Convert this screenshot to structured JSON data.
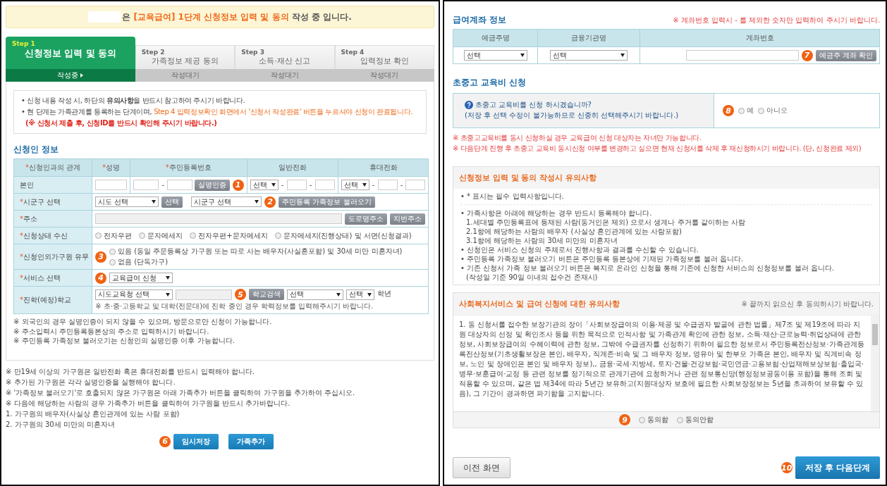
{
  "banner": {
    "segments": [
      {
        "text": "은 ",
        "highlighted": false
      },
      {
        "text": "[교육급여] 1단계 신청정보 입력 및 동의",
        "highlighted": true
      },
      {
        "text": " 작성 중 입니다.",
        "highlighted": false
      }
    ]
  },
  "steps": [
    {
      "step": "Step 1",
      "title": "신청정보 입력 및 동의",
      "status": "작성중",
      "selected": true
    },
    {
      "step": "Step 2",
      "title": "가족정보 제공 동의",
      "status": "작성대기",
      "selected": false
    },
    {
      "step": "Step 3",
      "title": "소득·재산 신고",
      "status": "작성대기",
      "selected": false
    },
    {
      "step": "Step 4",
      "title": "입력정보 확인",
      "status": "작성대기",
      "selected": false
    }
  ],
  "notice": [
    {
      "alert": false,
      "segments": [
        {
          "text": "• 신청 내용 작성 시, 하단의 **유의사항**을 반드시 참고하여 주시기 바랍니다.",
          "highlighted": false
        }
      ]
    },
    {
      "alert": false,
      "segments": [
        {
          "text": "• 현 단계는 가족관계를 등록하는 단계이며, ",
          "highlighted": false
        },
        {
          "text": "Step 4 입력정보확인 화면에서 '신청서 작성완료' 버튼을 누르셔야 신청이 완료됩니다.",
          "highlighted": true
        }
      ]
    },
    {
      "alert": true,
      "segments": [
        {
          "text": "(※ 신청서 제출 후, 신청ID를 반드시 확인해 주시기 바랍니다.)",
          "highlighted": false
        }
      ]
    }
  ],
  "applicant": {
    "title": "신청인 정보",
    "columns": [
      {
        "mark": "*",
        "label": "신청인과의 관계"
      },
      {
        "mark": "*",
        "label": "성명"
      },
      {
        "mark": "*",
        "label": "주민등록번호"
      },
      {
        "label": "일반전화"
      },
      {
        "label": "휴대전화"
      }
    ],
    "self_row": {
      "relation": "본인",
      "separator": "-",
      "verify_button": "실명인증",
      "marker": "1",
      "phone_select": "선택",
      "mobile_select": "선택"
    },
    "rows": [
      {
        "kind": "region",
        "mark": "*",
        "label": "시군구 선택",
        "province_select": "시도 선택",
        "select_button": "선택",
        "district_select": "시군구 선택",
        "load_button_marker": "2",
        "load_button": "주민등록 가족정보 불러오기"
      },
      {
        "kind": "address",
        "mark": "*",
        "label": "주소",
        "buttons": [
          "도로명주소",
          "지번주소"
        ]
      },
      {
        "kind": "radios",
        "mark": "*",
        "label": "신청상태 수신",
        "options": [
          {
            "label": "전자우편",
            "selected": false
          },
          {
            "label": "문자메세지",
            "selected": false
          },
          {
            "label": "전자우편+문자메세지",
            "selected": false
          },
          {
            "label": "문자메세지(진행상태) 및 서면(신청결과)",
            "selected": false
          }
        ]
      },
      {
        "kind": "radio_stack",
        "mark": "*",
        "label": "신청인외가구원 유무",
        "marker": "3",
        "options": [
          {
            "label": "있음 (동일 주문등록상 가구원 또는 따로 사는 배우자(사실혼포함) 및 30세 미만 미혼자녀)",
            "selected": false
          },
          {
            "label": "없음 (단독가구)",
            "selected": false
          }
        ]
      },
      {
        "kind": "service",
        "mark": "*",
        "label": "서비스 선택",
        "marker": "4",
        "select": "교육급여 신청"
      },
      {
        "kind": "school",
        "mark": "*",
        "label": "진학(예정)학교",
        "edu_select": "시도교육청 선택",
        "search_button_marker": "5",
        "search_button": "학교검색",
        "school_select": "선택",
        "grade_select": "선택",
        "grade_unit": "학년",
        "note": "※ 초·중·고등학교 및 대학(전문대)에 진학 중인 경우 학력정보를 입력해주시기 바랍니다."
      }
    ],
    "notes": [
      "※ 외국인의 경우 실명인증이 되지 않을 수 있으며, 방문으로만 신청이 가능합니다.",
      "※ 주소입력시 주민등록등본상의 주소로 입력하시기 바랍니다.",
      "※ 주민등록 가족정보 불러오기는 신청인의 실명인증 이후 가능합니다."
    ]
  },
  "family_notes": [
    "※ 만19세 이상의 가구원은 일반전화 혹은 휴대전화를 반드시 입력해야 합니다.",
    "※ 추가된 가구원은 각각 실명인증을 실행해야 합니다.",
    "※ '가족정보 불러오기'로 호출되지 않은 가구원은 아래 가족추가 버튼을 클릭하여 가구원을 추가하여 주십시오.",
    "※ 다음에 해당하는 사람의 경우 가족추가 버튼을 클릭하여 가구원을 반드시 추가바랍니다.",
    "1. 가구원의 배우자(사실상 혼인관계에 있는 사람 포함)",
    "2. 가구원의 30세 미만의 미혼자녀"
  ],
  "left_buttons": [
    {
      "marker": "6",
      "label": "임시저장"
    },
    {
      "label": "가족추가"
    }
  ],
  "account": {
    "title": "급여계좌 정보",
    "note": "※ 계좌번호 입력시 - 를 제외한 숫자만 입력하여 주시기 바랍니다.",
    "columns": [
      "예금주명",
      "금융기관명",
      "계좌번호"
    ],
    "holder_select": "선택",
    "bank_select": "선택",
    "marker": "7",
    "check_button": "예금주 계좌 확인"
  },
  "tuition": {
    "title": "초중고 교육비 신청",
    "question": "초중고 교육비를 신청 하시겠습니까?",
    "caution": "(저장 후 선택 수정이 불가능하므로 신중히 선택해주시기 바랍니다.)",
    "marker": "8",
    "options": [
      {
        "label": "예",
        "selected": false
      },
      {
        "label": "아니오",
        "selected": false
      }
    ],
    "notes": [
      "※ 초중고교육비를 동시 신청하실 경우 교육급여 신청 대상자는 자녀만 가능합니다.",
      "※ 다음단계 진행 후 초중고 교육비 동시신청 여부를 변경하고 싶으면 현재 신청서를 삭제 후 재신청하시기 바랍니다. (단, 신청완료 제외)"
    ]
  },
  "guide": {
    "title": "신청정보 입력 및 동의 작성시 유의사항",
    "groups": [
      {
        "lines": [
          {
            "kind": "bullet",
            "text": "• * 표시는 필수 입력사항입니다."
          }
        ]
      },
      {
        "lines": [
          {
            "kind": "bullet",
            "text": "• 가족사항은 아래에 해당하는 경우 반드시 등록해야 합니다."
          },
          {
            "kind": "sub",
            "text": "1.세대별 주민등록표에 등재된 사람(동거인은 제외) 으로서 생계나 주거를 같이하는 사람"
          },
          {
            "kind": "sub",
            "text": "2.1항에 해당하는 사람의 배우자 (사실상 혼인관계에 있는 사람포함)"
          },
          {
            "kind": "sub",
            "text": "3.1항에 해당하는 사람의 30세 미만의 미혼자녀"
          },
          {
            "kind": "bullet",
            "text": "• 신청인은 서비스 신청의 주체로서 진행사항과 결과를 수신할 수 있습니다."
          },
          {
            "kind": "bullet",
            "text": "• 주민등록 가족정보 불러오기 버튼은 주민등록 등본상에 기재된 가족정보를 불러 옵니다."
          },
          {
            "kind": "bullet",
            "text": "• 기존 신청서 가족 정보 불러오기 버튼은 복지로 온라인 신청을 통해 기존에 신청한 서비스의 신청정보를 불러 옵니다."
          },
          {
            "kind": "sub",
            "text": "(작성일 기준 90일 이내의 접수건 존재시)"
          }
        ]
      }
    ]
  },
  "consent": {
    "title": "사회복지서비스 및 급여 신청에 대한 유의사항",
    "hint": "※ 끝까지 읽으신 후 동의하시기 바랍니다.",
    "text": "1. 동 신청서를 접수한 보장기관의 장이「사회보장급여의 이용·제공 및 수급권자 발굴에 관한 법률」제7조 및 제19조에 따라 지원 대상자의 선정 및 확인조사 등을 위한 목적으로 인적사항 및 가족관계 확인에 관한 정보, 소득·재산·근로능력·취업상태에 관한 정보, 사회보장급여의 수혜이력에 관한 정보, 그밖에 수급권자를 선정하기 위하여 필요한 정보로서 주민등록전산정보·가족관계등록전산정보(기초생활보장은 본인, 배우자, 직계존·비속 및 그 배우자 정보, 영유아 및 한부모 가족은 본인, 배우자 및 직계비속 정보, 노인 및 장애인은 본인 및 배우자 정보),, 금융·국세·지방세, 토지·건물·건강보험·국민연금·고용보험·산업재해보상보험·출입국·병무·보훈급여·교정 등 관련 정보를 정기적으로 관계기관에 요청하거나 관련 정보통신망(행정정보공동이용 포함)을 통해 조회 및 적용할 수 있으며, 같은 법 제34에 따라 5년간 보유하고(지원대상자 보호에 필요한 사회보장정보는 5년을 초과하여 보유할 수 있음), 그 기간이 경과하면 파기함을 고지합니다.",
    "marker": "9",
    "options": [
      {
        "label": "동의함",
        "selected": false
      },
      {
        "label": "동의안함",
        "selected": false
      }
    ]
  },
  "nav": {
    "back": "이전 화면",
    "marker": "10",
    "next": "저장 후 다음단계"
  }
}
